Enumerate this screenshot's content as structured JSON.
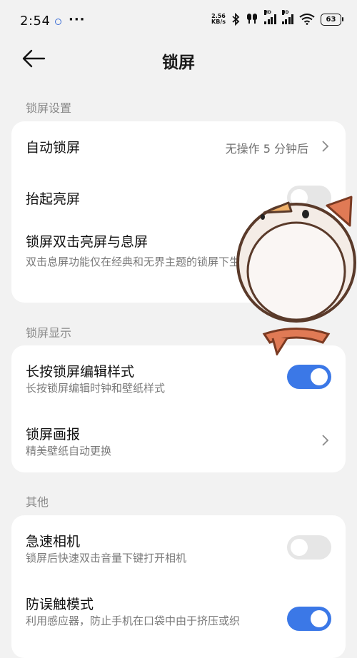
{
  "status_bar": {
    "time": "2:54",
    "more_dots": "···",
    "net_speed_value": "2.56",
    "net_speed_unit": "KB/s",
    "signal_label_1": "HD",
    "signal_label_2": "HD",
    "wifi_sub": "6",
    "battery": "63"
  },
  "header": {
    "title": "锁屏"
  },
  "sections": {
    "lock_settings": {
      "label": "锁屏设置",
      "auto_lock": {
        "title": "自动锁屏",
        "value": "无操作 5 分钟后"
      },
      "raise_to_wake": {
        "title": "抬起亮屏",
        "toggle": "off"
      },
      "double_tap": {
        "title": "锁屏双击亮屏与息屏",
        "subtitle": "双击息屏功能仅在经典和无界主题的锁屏下生效",
        "toggle": "on"
      }
    },
    "lock_display": {
      "label": "锁屏显示",
      "long_press": {
        "title": "长按锁屏编辑样式",
        "subtitle": "长按锁屏编辑时钟和壁纸样式",
        "toggle": "on"
      },
      "magazine": {
        "title": "锁屏画报",
        "subtitle": "精美壁纸自动更换"
      }
    },
    "other": {
      "label": "其他",
      "quick_camera": {
        "title": "急速相机",
        "subtitle": "锁屏后快速双击音量下键打开相机",
        "toggle": "off"
      },
      "anti_mistouch": {
        "title": "防误触模式",
        "subtitle": "利用感应器，防止手机在口袋中由于挤压或织",
        "toggle": "on"
      }
    }
  },
  "colors": {
    "accent": "#3b78e7",
    "background": "#f2f2f2",
    "card": "#ffffff"
  }
}
